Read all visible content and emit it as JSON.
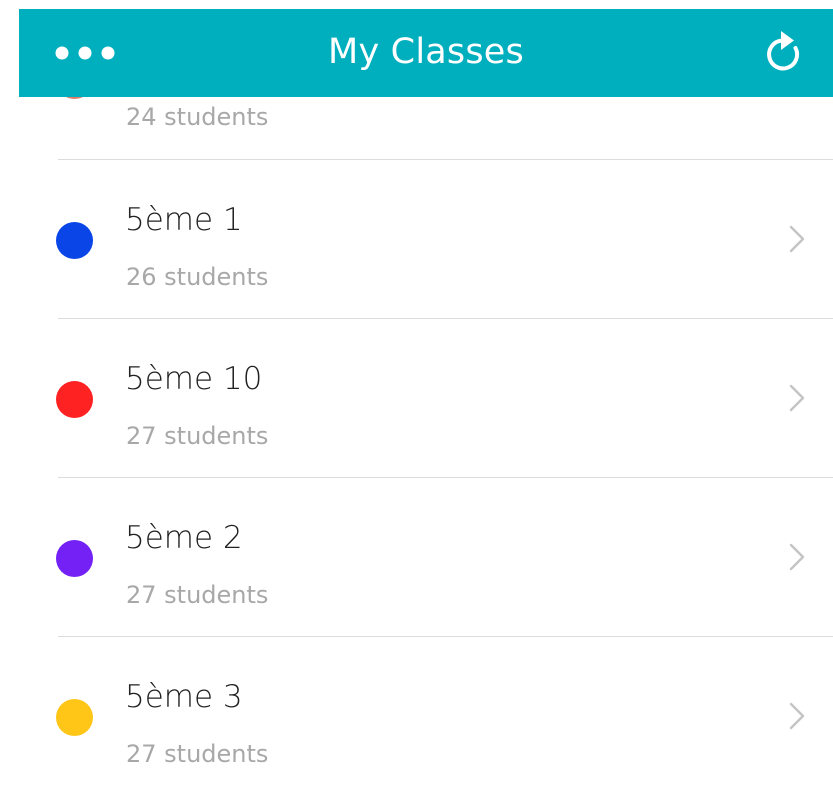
{
  "header": {
    "title": "My Classes",
    "more_icon": "more-horizontal-icon",
    "refresh_icon": "refresh-icon",
    "background_color": "#00afbe"
  },
  "classes": [
    {
      "name": "",
      "students": "24 students",
      "color": "#e07a6a"
    },
    {
      "name": "5ème 1",
      "students": "26 students",
      "color": "#0a45e8"
    },
    {
      "name": "5ème 10",
      "students": "27 students",
      "color": "#ff2222"
    },
    {
      "name": "5ème 2",
      "students": "27 students",
      "color": "#7321f5"
    },
    {
      "name": "5ème 3",
      "students": "27 students",
      "color": "#ffc617"
    }
  ],
  "chevron_icon": "chevron-right-icon"
}
